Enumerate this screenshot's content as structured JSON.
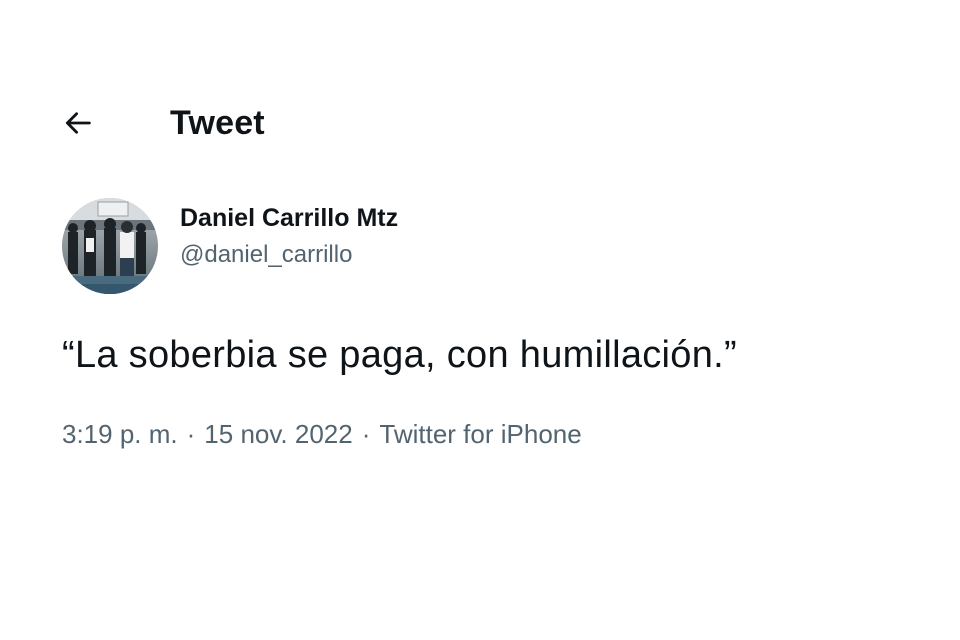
{
  "header": {
    "title": "Tweet",
    "back_icon": "arrow-left-icon"
  },
  "author": {
    "display_name": "Daniel Carrillo Mtz",
    "handle": "@daniel_carrillo",
    "avatar": "photo"
  },
  "tweet": {
    "text": "“La soberbia se paga, con humillación.”"
  },
  "meta": {
    "time": "3:19 p. m.",
    "separator": "·",
    "date": "15 nov. 2022",
    "source": "Twitter for iPhone"
  },
  "colors": {
    "text_primary": "#0f1419",
    "text_secondary": "#536471",
    "background": "#ffffff"
  }
}
